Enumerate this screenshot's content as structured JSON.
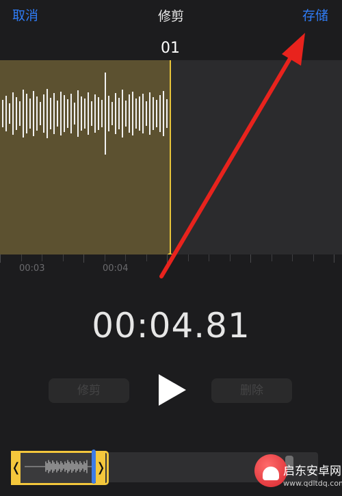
{
  "topbar": {
    "cancel_label": "取消",
    "title": "修剪",
    "save_label": "存储"
  },
  "marker_label": "01",
  "ruler": {
    "labels": [
      "00:03",
      "00:04"
    ]
  },
  "time_display": "00:04.81",
  "controls": {
    "trim_label": "修剪",
    "delete_label": "删除"
  },
  "scrubber": {
    "left_handle": "❬",
    "right_handle": "❭"
  },
  "watermark": {
    "line1": "启东安卓网",
    "line2": "www.qdltdq.com"
  },
  "colors": {
    "accent_blue": "#2f7cf6",
    "selection_yellow": "#f4c73c",
    "selected_region": "#5c5130",
    "annotation_red": "#e8231d"
  },
  "icons": {
    "play": "play-icon",
    "arrow": "red-arrow-annotation"
  }
}
